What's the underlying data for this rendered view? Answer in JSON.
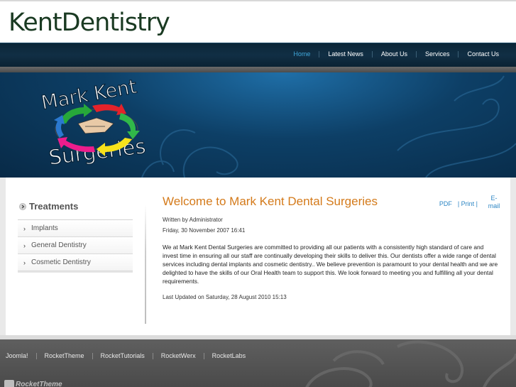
{
  "site": {
    "logo_text": "KentDentistry"
  },
  "nav": {
    "items": [
      {
        "label": "Home",
        "active": true
      },
      {
        "label": "Latest News"
      },
      {
        "label": "About Us"
      },
      {
        "label": "Services"
      },
      {
        "label": "Contact Us"
      }
    ]
  },
  "banner": {
    "logo_line1": "Mark Kent",
    "logo_line2": "Surgeries"
  },
  "sidebar": {
    "title": "Treatments",
    "items": [
      {
        "label": "Implants"
      },
      {
        "label": "General Dentistry"
      },
      {
        "label": "Cosmetic Dentistry"
      }
    ]
  },
  "article": {
    "title": "Welcome to Mark Kent Dental Surgeries",
    "tools": {
      "pdf": "PDF",
      "print": "| Print |",
      "email": "E-mail"
    },
    "author": "Written by Administrator",
    "date": "Friday, 30 November 2007 16:41",
    "body": "We at Mark Kent Dental Surgeries are committed to providing all our patients with a consistently high standard of care and invest time in ensuring all our staff are continually developing their skills to deliver this. Our dentists offer a wide range of dental services including dental implants and cosmetic dentistry.. We believe prevention is paramount to your dental health and we are delighted to have the skills of our Oral Health team to support this. We look forward to meeting you and fulfilling all your dental requirements.",
    "updated": "Last Updated on Saturday, 28 August 2010 15:13"
  },
  "footer": {
    "links": [
      "Joomla!",
      "RocketTheme",
      "RocketTutorials",
      "RocketWerx",
      "RocketLabs"
    ],
    "brand": "RocketTheme"
  },
  "colors": {
    "accent": "#d47a1a",
    "nav_active": "#3fa6d8",
    "link": "#2d86c4",
    "logo_green": "#1a3a22"
  }
}
